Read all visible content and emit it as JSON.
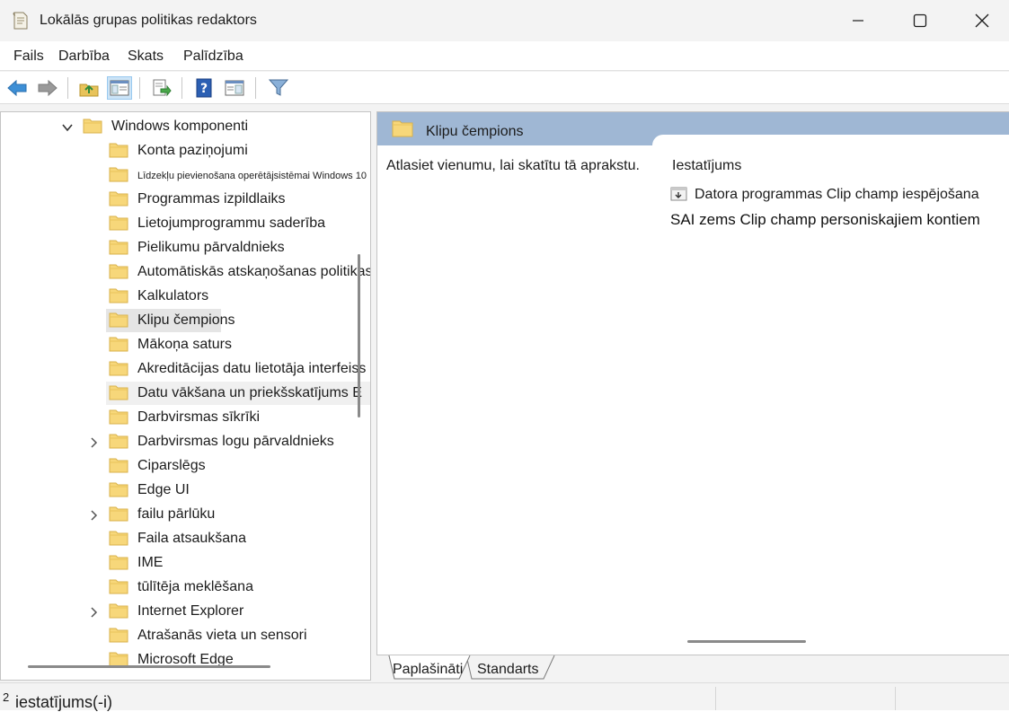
{
  "window": {
    "title": "Lokālās grupas politikas redaktors",
    "controls": {
      "minimize": "minimize-icon",
      "maximize": "maximize-icon",
      "close": "close-icon"
    }
  },
  "menu": [
    "Fails",
    "Darbība",
    "Skats",
    "Palīdzība"
  ],
  "toolbar": {
    "buttons": [
      "back-arrow-icon",
      "forward-arrow-icon",
      "up-folder-icon",
      "show-hide-tree-icon",
      "export-list-icon",
      "help-icon",
      "extended-view-icon",
      "filter-icon"
    ],
    "pressed": "show-hide-tree-icon"
  },
  "tree": {
    "parent": "Windows komponenti",
    "items": [
      {
        "label": "Konta paziņojumi",
        "expandable": false
      },
      {
        "label": "Līdzekļu pievienošana operētājsistēmai Windows 10",
        "expandable": false
      },
      {
        "label": "Programmas izpildlaiks",
        "expandable": false
      },
      {
        "label": "Lietojumprogrammu saderība",
        "expandable": false
      },
      {
        "label": "Pielikumu pārvaldnieks",
        "expandable": false
      },
      {
        "label": "Automātiskās atskaņošanas politikas",
        "expandable": false
      },
      {
        "label": "Kalkulators",
        "expandable": false
      },
      {
        "label": "Klipu čempions",
        "expandable": false,
        "selected": true
      },
      {
        "label": "Mākoņa saturs",
        "expandable": false
      },
      {
        "label": "Akreditācijas datu lietotāja interfeiss",
        "expandable": false
      },
      {
        "label": "Datu vākšana un priekšskatījums E",
        "expandable": false
      },
      {
        "label": "Darbvirsmas sīkrīki",
        "expandable": false
      },
      {
        "label": "Darbvirsmas logu pārvaldnieks",
        "expandable": true
      },
      {
        "label": "Ciparslēgs",
        "expandable": false
      },
      {
        "label": "Edge UI",
        "expandable": false
      },
      {
        "label": "failu pārlūku",
        "expandable": true
      },
      {
        "label": "Faila atsaukšana",
        "expandable": false
      },
      {
        "label": "IME",
        "expandable": false
      },
      {
        "label": "tūlītēja meklēšana",
        "expandable": false
      },
      {
        "label": "Internet Explorer",
        "expandable": true
      },
      {
        "label": "Atrašanās vieta un sensori",
        "expandable": false
      },
      {
        "label": "Microsoft Edge",
        "expandable": false
      }
    ]
  },
  "details": {
    "header": "Klipu čempions",
    "description": "Atlasiet vienumu, lai skatītu tā aprakstu.",
    "column_header": "Iestatījums",
    "settings": [
      {
        "label": "Datora programmas Clip champ iespējošana",
        "icon": "policy-setting-icon"
      }
    ],
    "subtitle": "SAI zems Clip champ personiskajiem kontiem"
  },
  "tabs": [
    {
      "label": "Paplašināti",
      "active": true
    },
    {
      "label": "Standarts",
      "active": false
    }
  ],
  "status": {
    "count": "2",
    "text": "iestatījums(-i)"
  },
  "colors": {
    "header_band": "#9fb7d4",
    "folder": "#f7d77a",
    "selection": "#e5e5e5"
  }
}
